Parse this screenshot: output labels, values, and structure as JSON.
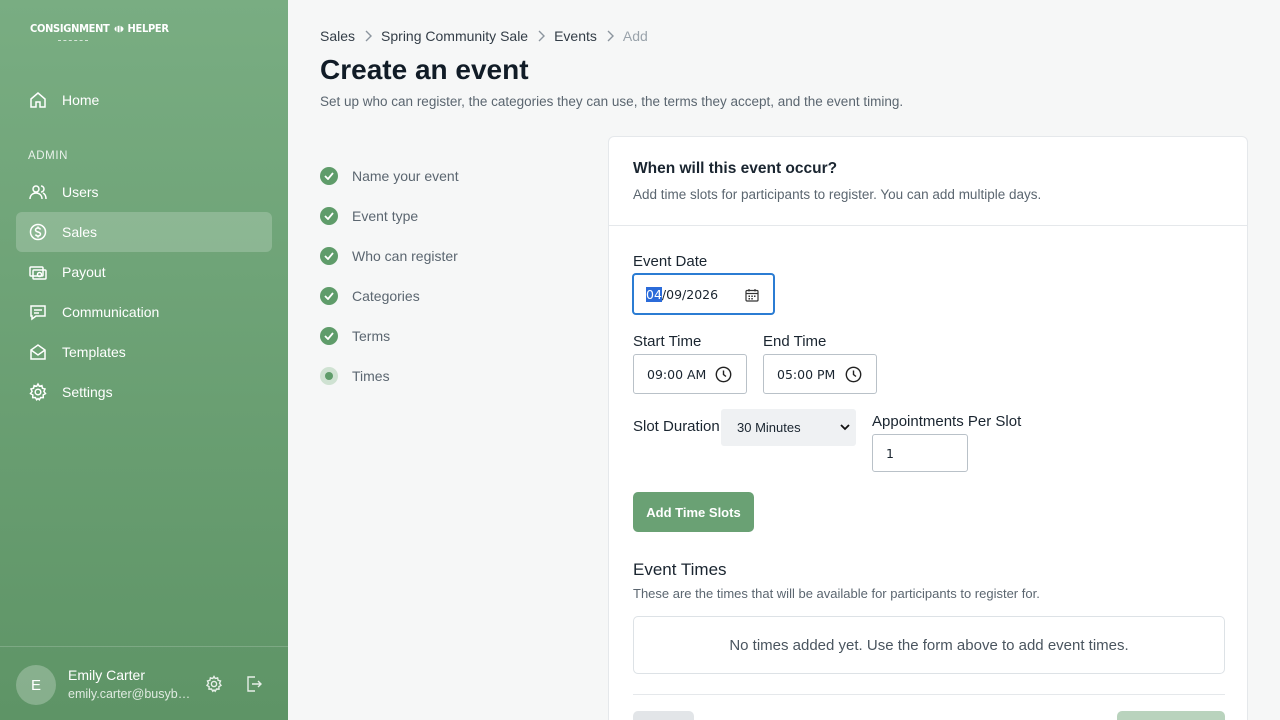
{
  "app": {
    "logo_left": "CONSIGNMENT",
    "logo_right": "HELPER"
  },
  "sidebar": {
    "section_label": "ADMIN",
    "items": [
      {
        "label": "Home",
        "icon": "home-icon"
      },
      {
        "label": "Users",
        "icon": "users-icon"
      },
      {
        "label": "Sales",
        "icon": "dollar-icon",
        "active": true
      },
      {
        "label": "Payout",
        "icon": "payout-icon"
      },
      {
        "label": "Communication",
        "icon": "chat-icon"
      },
      {
        "label": "Templates",
        "icon": "mail-icon"
      },
      {
        "label": "Settings",
        "icon": "gear-icon"
      }
    ],
    "user": {
      "initial": "E",
      "name": "Emily Carter",
      "email": "emily.carter@busybee.example"
    }
  },
  "breadcrumb": [
    "Sales",
    "Spring Community Sale",
    "Events",
    "Add"
  ],
  "page": {
    "title": "Create an event",
    "subtitle": "Set up who can register, the categories they can use, the terms they accept, and the event timing."
  },
  "steps": [
    {
      "label": "Name your event",
      "status": "complete"
    },
    {
      "label": "Event type",
      "status": "complete"
    },
    {
      "label": "Who can register",
      "status": "complete"
    },
    {
      "label": "Categories",
      "status": "complete"
    },
    {
      "label": "Terms",
      "status": "complete"
    },
    {
      "label": "Times",
      "status": "current"
    }
  ],
  "card": {
    "title": "When will this event occur?",
    "description": "Add time slots for participants to register. You can add multiple days.",
    "event_date": {
      "label": "Event Date",
      "month": "04",
      "rest": "/09/2026"
    },
    "start_time": {
      "label": "Start Time",
      "value": "09:00 AM"
    },
    "end_time": {
      "label": "End Time",
      "value": "05:00 PM"
    },
    "slot_duration": {
      "label": "Slot Duration",
      "value": "30 Minutes"
    },
    "appointments": {
      "label": "Appointments Per Slot",
      "value": "1"
    },
    "add_button": "Add Time Slots",
    "event_times": {
      "title": "Event Times",
      "description": "These are the times that will be available for participants to register for.",
      "empty": "No times added yet. Use the form above to add event times."
    }
  },
  "colors": {
    "sidebar": "#6fa479",
    "accent": "#6aa174",
    "focus": "#2b7cd3"
  }
}
